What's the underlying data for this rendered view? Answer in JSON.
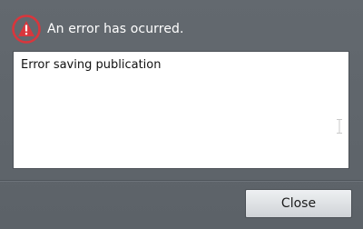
{
  "dialog": {
    "title": "An error has ocurred.",
    "icon": "error-warning-icon",
    "message": "Error saving publication",
    "close_label": "Close",
    "accent_color": "#d9363c"
  }
}
